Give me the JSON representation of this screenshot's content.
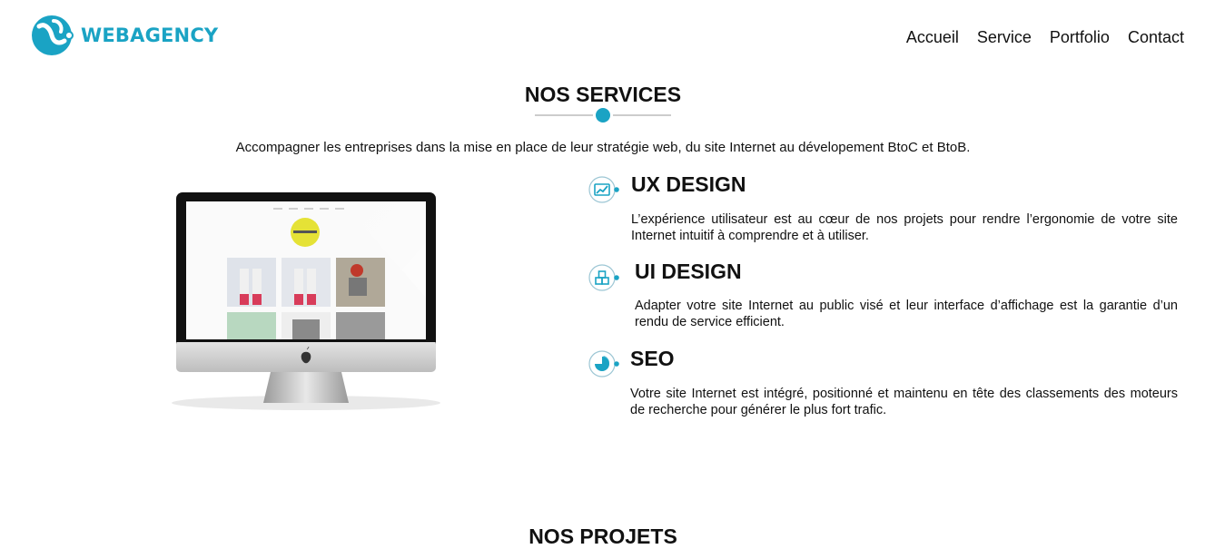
{
  "brand": {
    "name": "WEBAGENCY",
    "accent": "#1aa3c4"
  },
  "nav": {
    "items": [
      "Accueil",
      "Service",
      "Portfolio",
      "Contact"
    ]
  },
  "services_section": {
    "title": "NOS SERVICES",
    "intro": "Accompagner les entreprises dans la mise en place de leur stratégie web, du site Internet au dévelopement BtoC et BtoB.",
    "items": [
      {
        "icon": "chart-growth-icon",
        "title": "UX DESIGN",
        "desc": "L’expérience utilisateur est au cœur de nos projets pour rendre l’ergonomie de votre site Internet intuitif à comprendre et à utiliser."
      },
      {
        "icon": "cubes-icon",
        "title": "UI DESIGN",
        "desc": "Adapter votre site Internet au public visé et leur interface d’affichage est la garantie d’un rendu de service efficient."
      },
      {
        "icon": "pie-chart-icon",
        "title": "SEO",
        "desc": "Votre site Internet est intégré, positionné et maintenu en tête des classements des moteurs de recherche pour générer le plus fort trafic."
      }
    ]
  },
  "projects_section": {
    "title": "NOS PROJETS"
  }
}
